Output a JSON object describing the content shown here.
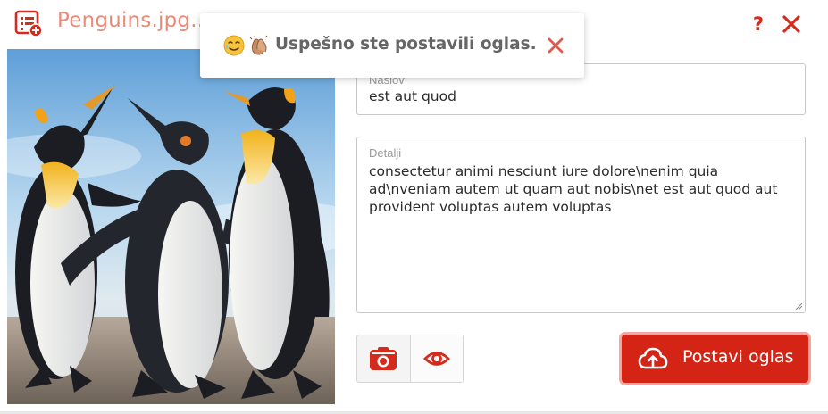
{
  "header": {
    "title": "Penguins.jpg...",
    "help_label": "?",
    "icon": "list-add-icon",
    "close_icon": "close-icon"
  },
  "photo": {
    "subject": "penguins-photo"
  },
  "form": {
    "title_field": {
      "label": "Naslov",
      "value": "est aut quod"
    },
    "details_field": {
      "label": "Detalji",
      "value": "consectetur animi nesciunt iure dolore\\nenim quia ad\\nveniam autem ut quam aut nobis\\net est aut quod aut provident voluptas autem voluptas"
    }
  },
  "actions": {
    "camera_icon": "camera-icon",
    "preview_icon": "eye-icon",
    "submit_label": "Postavi oglas",
    "submit_icon": "cloud-upload-icon"
  },
  "toast": {
    "message": "Uspešno ste postavili oglas.",
    "emoji": [
      "smiling-face-with-tear-emoji",
      "clapping-hands-emoji"
    ],
    "close_icon": "close-icon"
  },
  "colors": {
    "accent": "#d42416",
    "title": "#e88b78",
    "toast_text": "#666666"
  }
}
